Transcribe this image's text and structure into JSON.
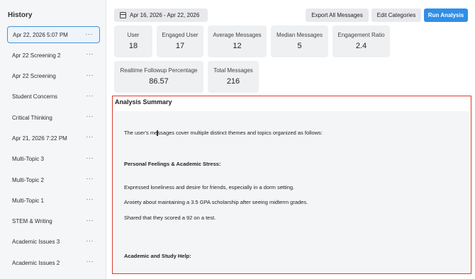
{
  "sidebar": {
    "title": "History",
    "items": [
      {
        "label": "Apr 22, 2026 5:07 PM",
        "active": true
      },
      {
        "label": "Apr 22 Screening 2"
      },
      {
        "label": "Apr 22 Screening"
      },
      {
        "label": "Student Concerns"
      },
      {
        "label": "Critical Thinking"
      },
      {
        "label": "Apr 21, 2026 7:22 PM"
      },
      {
        "label": "Multi-Topic 3"
      },
      {
        "label": "Multi-Topic 2"
      },
      {
        "label": "Multi-Topic 1"
      },
      {
        "label": "STEM & Writing"
      },
      {
        "label": "Academic Issues 3"
      },
      {
        "label": "Academic Issues 2"
      }
    ],
    "menu_glyph": "···"
  },
  "toolbar": {
    "date_range": "Apr 16, 2026 - Apr 22, 2026",
    "export_label": "Export All Messages",
    "edit_label": "Edit Categories",
    "run_label": "Run Analysis"
  },
  "stats": [
    {
      "label": "User",
      "value": "18"
    },
    {
      "label": "Engaged User",
      "value": "17"
    },
    {
      "label": "Average Messages",
      "value": "12"
    },
    {
      "label": "Median Messages",
      "value": "5"
    },
    {
      "label": "Engagement Ratio",
      "value": "2.4"
    },
    {
      "label": "Realtime Followup Percentage",
      "value": "86.57"
    },
    {
      "label": "Total Messages",
      "value": "216"
    }
  ],
  "analysis": {
    "title": "Analysis Summary",
    "paragraphs": [
      "The user's messages cover multiple distinct themes and topics organized as follows:",
      "Personal Feelings & Academic Stress:",
      "Expressed loneliness and desire for friends, especially in a dorm setting.",
      "Anxiety about maintaining a 3.5 GPA scholarship after seeing midterm grades.",
      "Shared that they scored a 92 on a test.",
      "Academic and Study Help:"
    ]
  },
  "colors": {
    "accent": "#2f8fe8",
    "highlight_border": "#d93a2b",
    "active_border": "#4a8fd6"
  }
}
